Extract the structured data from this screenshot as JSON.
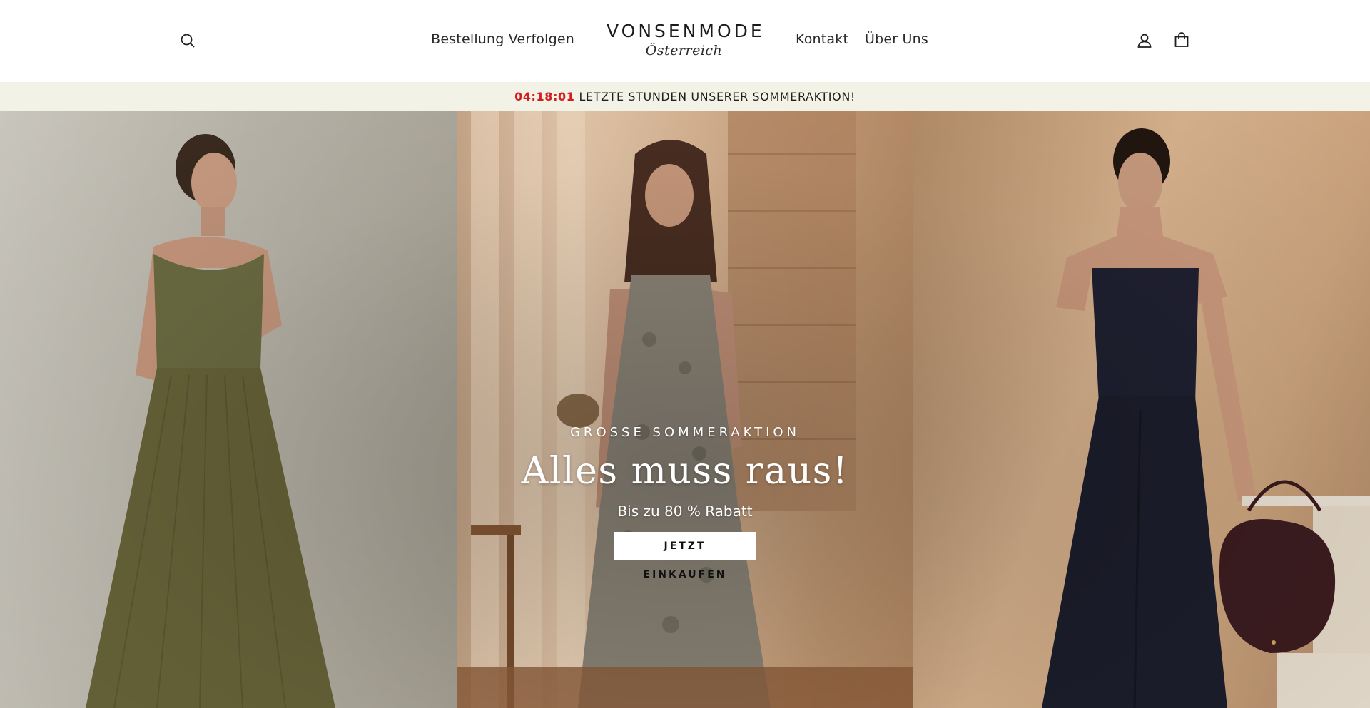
{
  "header": {
    "logo": {
      "name": "VONSENMODE",
      "sub": "Österreich"
    },
    "nav": {
      "track_order": "Bestellung Verfolgen",
      "contact": "Kontakt",
      "about": "Über Uns"
    },
    "icons": {
      "search": "search-icon",
      "account": "user-icon",
      "cart": "shopping-bag-icon"
    }
  },
  "announcement": {
    "timer": "04:18:01",
    "text": "LETZTE STUNDEN UNSERER SOMMERAKTION!",
    "timer_color": "#d11e1e",
    "background": "#f3f2e7"
  },
  "hero": {
    "eyebrow": "GROSSE SOMMERAKTION",
    "title": "Alles muss raus!",
    "subtitle": "Bis zu 80 % Rabatt",
    "cta": "JETZT EINKAUFEN"
  }
}
